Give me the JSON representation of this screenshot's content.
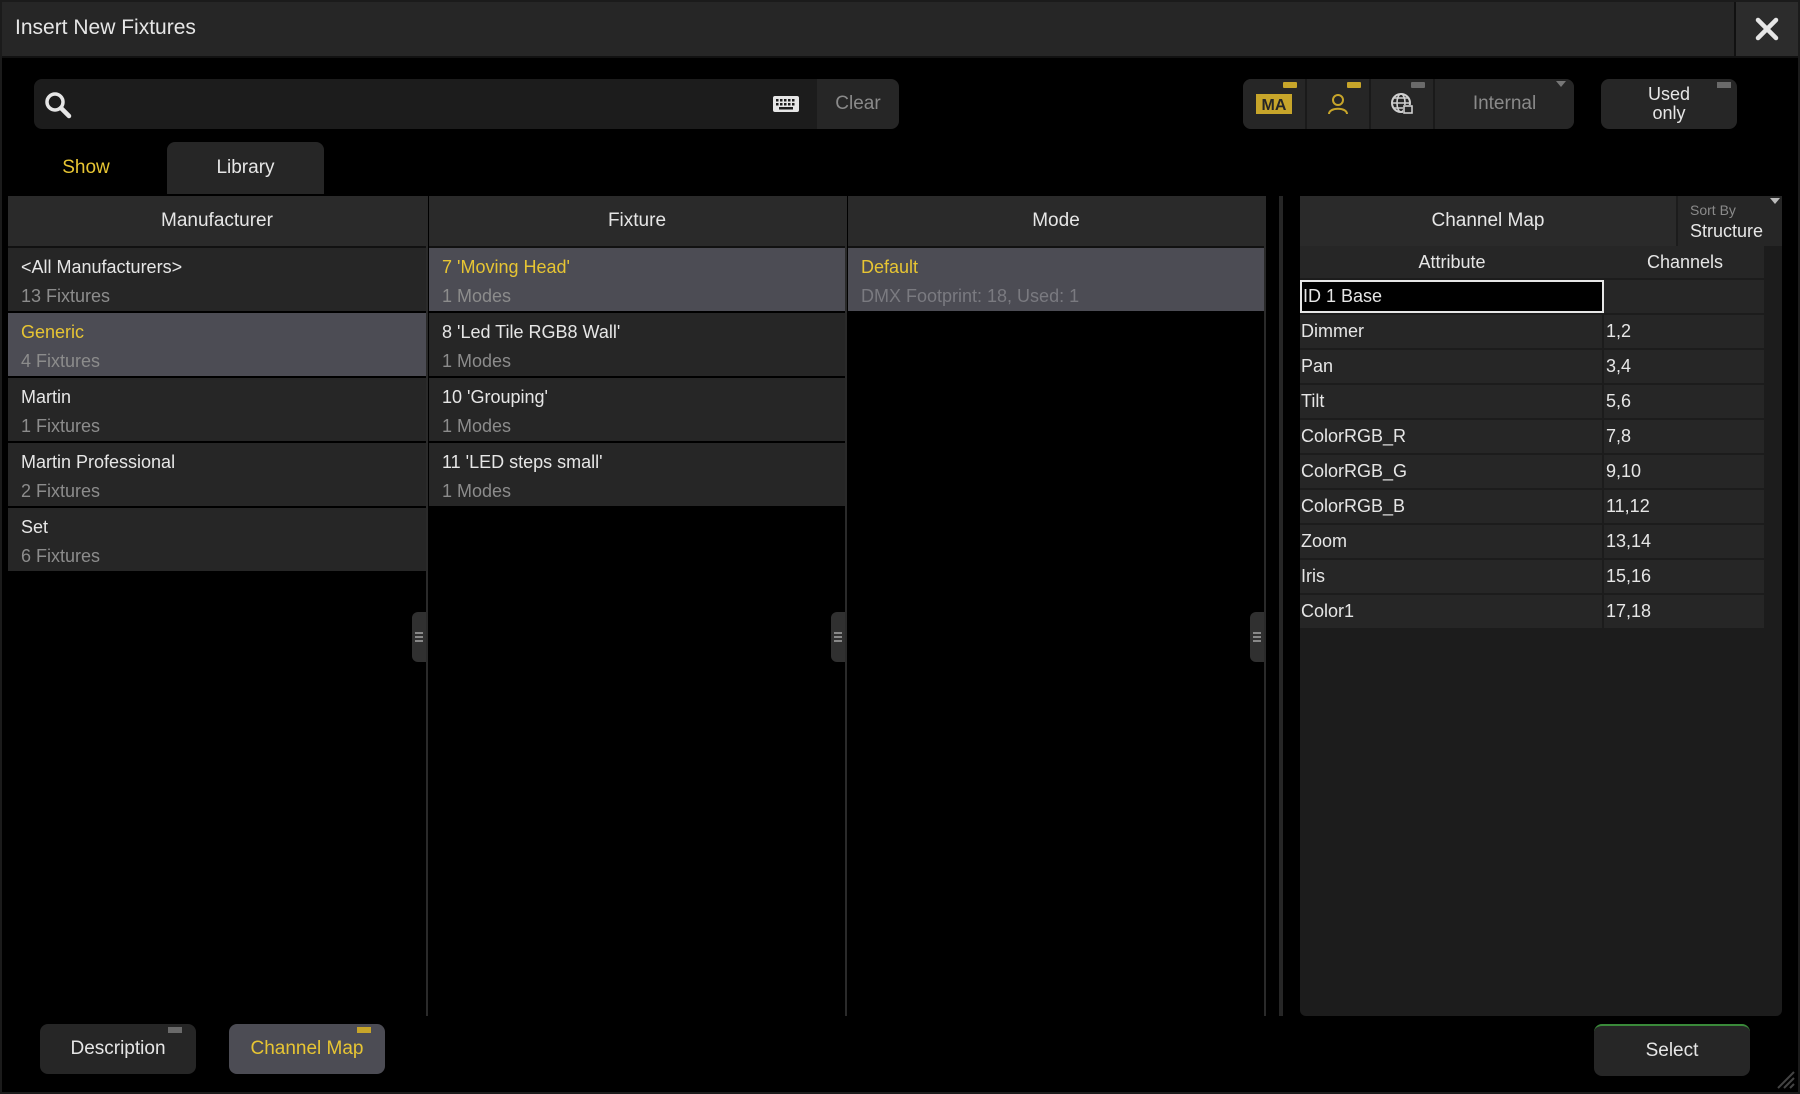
{
  "window": {
    "title": "Insert New Fixtures"
  },
  "search": {
    "value": "",
    "placeholder": "",
    "clear_label": "Clear"
  },
  "filters": {
    "internal_label": "Internal",
    "used_only_label": "Used only",
    "ma_label": "MA"
  },
  "tabs": [
    {
      "label": "Show",
      "active": true
    },
    {
      "label": "Library",
      "active": false
    }
  ],
  "manufacturer": {
    "header": "Manufacturer",
    "items": [
      {
        "name": "<All Manufacturers>",
        "count": "13 Fixtures",
        "selected": false
      },
      {
        "name": "Generic",
        "count": "4 Fixtures",
        "selected": true
      },
      {
        "name": "Martin",
        "count": "1 Fixtures",
        "selected": false
      },
      {
        "name": "Martin Professional",
        "count": "2 Fixtures",
        "selected": false
      },
      {
        "name": "Set",
        "count": "6 Fixtures",
        "selected": false
      }
    ]
  },
  "fixture": {
    "header": "Fixture",
    "items": [
      {
        "name": "7 'Moving Head'",
        "modes": "1 Modes",
        "selected": true
      },
      {
        "name": "8 'Led Tile RGB8 Wall'",
        "modes": "1 Modes",
        "selected": false
      },
      {
        "name": "10 'Grouping'",
        "modes": "1 Modes",
        "selected": false
      },
      {
        "name": "11 'LED steps small'",
        "modes": "1 Modes",
        "selected": false
      }
    ]
  },
  "mode": {
    "header": "Mode",
    "items": [
      {
        "name": "Default",
        "info": "DMX Footprint:  18, Used: 1",
        "selected": true
      }
    ]
  },
  "channel_map": {
    "header": "Channel Map",
    "sort_by_label": "Sort By",
    "sort_by_value": "Structure",
    "col_attribute": "Attribute",
    "col_channels": "Channels",
    "rows": [
      {
        "attribute": "ID 1  Base",
        "channels": ""
      },
      {
        "attribute": "Dimmer",
        "channels": "1,2"
      },
      {
        "attribute": "Pan",
        "channels": "3,4"
      },
      {
        "attribute": "Tilt",
        "channels": "5,6"
      },
      {
        "attribute": "ColorRGB_R",
        "channels": "7,8"
      },
      {
        "attribute": "ColorRGB_G",
        "channels": "9,10"
      },
      {
        "attribute": "ColorRGB_B",
        "channels": "11,12"
      },
      {
        "attribute": "Zoom",
        "channels": "13,14"
      },
      {
        "attribute": "Iris",
        "channels": "15,16"
      },
      {
        "attribute": "Color1",
        "channels": "17,18"
      }
    ]
  },
  "bottom": {
    "description_label": "Description",
    "channel_map_label": "Channel Map",
    "select_label": "Select"
  },
  "colors": {
    "accent": "#e7c533",
    "selected_row": "#4c4c54",
    "button": "#262626"
  }
}
